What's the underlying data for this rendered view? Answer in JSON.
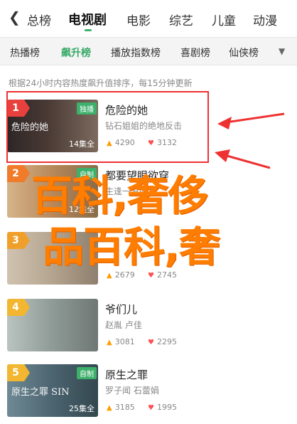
{
  "top_nav": {
    "back_icon": "chevron-left-icon",
    "tabs": [
      "总榜",
      "电视剧",
      "电影",
      "综艺",
      "儿童",
      "动漫"
    ],
    "active_index": 1
  },
  "sub_nav": {
    "items": [
      "热播榜",
      "飙升榜",
      "播放指数榜",
      "喜剧榜",
      "仙侠榜"
    ],
    "active_index": 1,
    "more_icon": "chevron-down-icon"
  },
  "hint": "根据24小时内容热度飙升值排序，每15分钟更新",
  "items": [
    {
      "rank": "1",
      "title": "危险的她",
      "cast": "钻石姐姐的绝地反击",
      "badge": "独播",
      "episodes": "14集全",
      "heat": "4290",
      "likes": "3132",
      "poster_text": "危险的她",
      "rank_color": "#e8403c"
    },
    {
      "rank": "2",
      "title": "都要望眼欲穿",
      "cast": "生逢一方同",
      "badge": "自制",
      "episodes": "12集全",
      "heat": "",
      "likes": "",
      "poster_text": "",
      "rank_color": "#f07b2a"
    },
    {
      "rank": "3",
      "title": "",
      "cast": "",
      "badge": "",
      "episodes": "",
      "heat": "2679",
      "likes": "2745",
      "poster_text": "",
      "rank_color": "#f0a02a"
    },
    {
      "rank": "4",
      "title": "爷们儿",
      "cast": "赵胤 卢佳",
      "badge": "",
      "episodes": "",
      "heat": "3081",
      "likes": "2295",
      "poster_text": "",
      "rank_color": "#f2b630"
    },
    {
      "rank": "5",
      "title": "原生之罪",
      "cast": "罗子闻 石蕾娟",
      "badge": "自制",
      "episodes": "25集全",
      "heat": "3185",
      "likes": "1995",
      "poster_text": "原生之罪 SIN",
      "rank_color": "#f2b630"
    }
  ],
  "watermark": {
    "line1": "百科,奢侈",
    "line2": "品百科,奢"
  },
  "colors": {
    "accent_green": "#37a866",
    "highlight_red": "#ee3232",
    "watermark_orange": "#ff7d00"
  }
}
